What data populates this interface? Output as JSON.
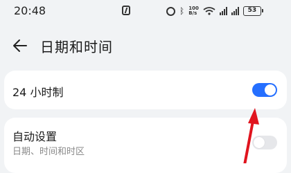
{
  "status_bar": {
    "time": "20:48",
    "speed_top": "100",
    "speed_unit": "B/s",
    "signal1_label": "HD",
    "signal2_label": "HD",
    "battery_level": "53",
    "icons": [
      "nfc-icon",
      "alarm-icon",
      "bluetooth-icon",
      "wifi-icon",
      "signal-icon",
      "battery-icon"
    ]
  },
  "header": {
    "title": "日期和时间",
    "back_icon": "arrow-left-icon"
  },
  "settings": {
    "hour24": {
      "label": "24 小时制",
      "enabled": true
    },
    "auto": {
      "label": "自动设置",
      "sublabel": "日期、时间和时区",
      "enabled": false
    }
  },
  "colors": {
    "accent": "#256fff",
    "background": "#f1f3f5",
    "card": "#ffffff",
    "annotation": "#e0141e"
  }
}
